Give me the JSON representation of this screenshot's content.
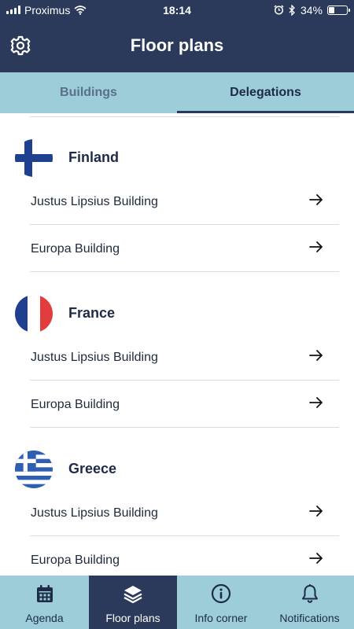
{
  "status_bar": {
    "carrier": "Proximus",
    "time": "18:14",
    "battery_percent": "34%",
    "battery_level": 0.34
  },
  "header": {
    "title": "Floor plans",
    "settings_icon": "gear-icon"
  },
  "tabs": [
    {
      "label": "Buildings",
      "active": false
    },
    {
      "label": "Delegations",
      "active": true
    }
  ],
  "countries": [
    {
      "name": "Finland",
      "flag": "finland-flag",
      "buildings": [
        "Justus Lipsius Building",
        "Europa Building"
      ]
    },
    {
      "name": "France",
      "flag": "france-flag",
      "buildings": [
        "Justus Lipsius Building",
        "Europa Building"
      ]
    },
    {
      "name": "Greece",
      "flag": "greece-flag",
      "buildings": [
        "Justus Lipsius Building",
        "Europa Building"
      ]
    }
  ],
  "bottom_nav": [
    {
      "label": "Agenda",
      "icon": "calendar-icon",
      "active": false
    },
    {
      "label": "Floor plans",
      "icon": "layers-icon",
      "active": true
    },
    {
      "label": "Info corner",
      "icon": "info-icon",
      "active": false
    },
    {
      "label": "Notifications",
      "icon": "bell-icon",
      "active": false
    }
  ],
  "colors": {
    "header_bg": "#2b3a5a",
    "tab_bg": "#9ccdd8",
    "text_dark": "#1e2b47"
  }
}
